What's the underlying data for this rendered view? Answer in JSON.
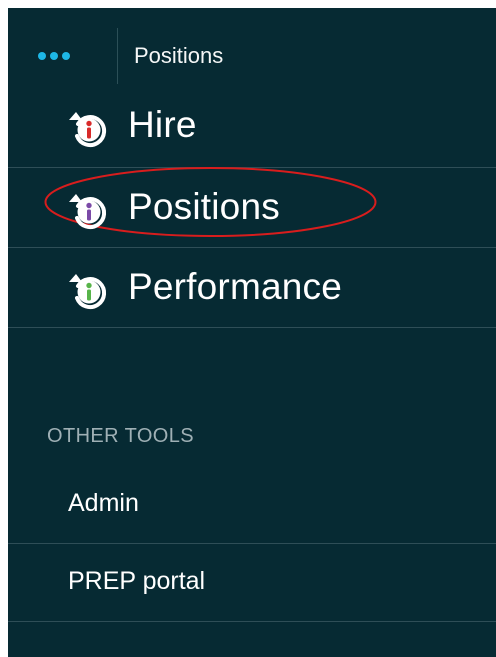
{
  "header": {
    "title": "Positions",
    "menu_icon": "more-dots-icon"
  },
  "nav": {
    "items": [
      {
        "label": "Hire",
        "icon": "refresh-person-icon",
        "accent_color": "#d82a2a"
      },
      {
        "label": "Positions",
        "icon": "refresh-person-icon",
        "accent_color": "#7b4aa7",
        "selected": true
      },
      {
        "label": "Performance",
        "icon": "refresh-person-icon",
        "accent_color": "#58b44a"
      }
    ]
  },
  "other_tools": {
    "heading": "OTHER TOOLS",
    "items": [
      {
        "label": "Admin"
      },
      {
        "label": "PREP portal"
      }
    ]
  },
  "colors": {
    "background": "#062a33",
    "divider": "#2e4e57",
    "highlight": "#d81d1d",
    "dots": "#1db7e6"
  }
}
